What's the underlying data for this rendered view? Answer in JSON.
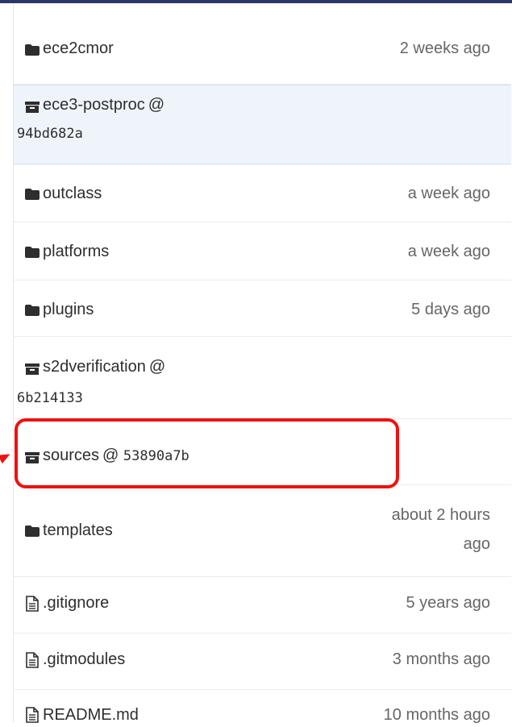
{
  "files": [
    {
      "type": "folder",
      "name": "ece2cmor",
      "time": "2 weeks ago"
    },
    {
      "type": "submodule",
      "name": "ece3-postproc",
      "at": "@",
      "hash": "94bd682a",
      "time": ""
    },
    {
      "type": "folder",
      "name": "outclass",
      "time": "a week ago"
    },
    {
      "type": "folder",
      "name": "platforms",
      "time": "a week ago"
    },
    {
      "type": "folder",
      "name": "plugins",
      "time": "5 days ago"
    },
    {
      "type": "submodule",
      "name": "s2dverification",
      "at": "@",
      "hash": "6b214133",
      "time": ""
    },
    {
      "type": "submodule",
      "name": "sources",
      "at": "@",
      "hash": "53890a7b",
      "time": ""
    },
    {
      "type": "folder",
      "name": "templates",
      "time_line1": "about 2 hours",
      "time_line2": "ago"
    },
    {
      "type": "file",
      "name": ".gitignore",
      "time": "5 years ago"
    },
    {
      "type": "file",
      "name": ".gitmodules",
      "time": "3 months ago"
    },
    {
      "type": "file",
      "name": "README.md",
      "time": "10 months ago"
    }
  ],
  "colors": {
    "header_bar": "#2f3567",
    "highlight_row": "#eef4fa",
    "callout": "#ee1111"
  }
}
